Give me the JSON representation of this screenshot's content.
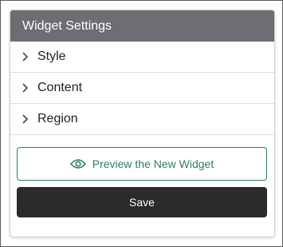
{
  "panel": {
    "title": "Widget Settings"
  },
  "sections": [
    {
      "label": "Style",
      "icon": "chevron-right-icon"
    },
    {
      "label": "Content",
      "icon": "chevron-right-icon"
    },
    {
      "label": "Region",
      "icon": "chevron-right-icon"
    }
  ],
  "actions": {
    "preview_label": "Preview the New Widget",
    "preview_icon": "eye-icon",
    "save_label": "Save"
  },
  "colors": {
    "header_bg": "#6c6e73",
    "accent_green": "#2e7d5b",
    "save_bg": "#2b2b2b"
  }
}
